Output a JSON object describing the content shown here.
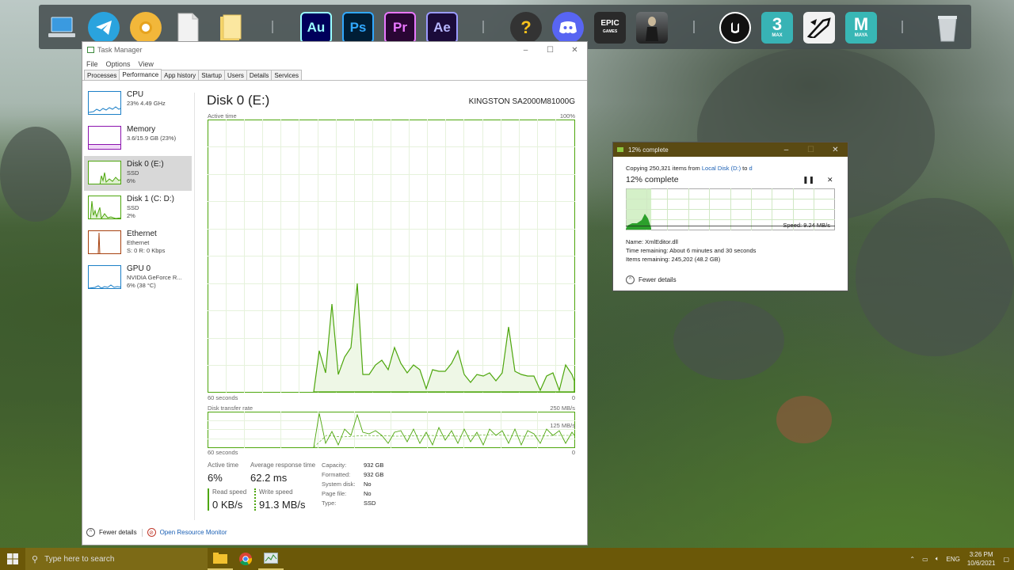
{
  "dock": {
    "icons": [
      {
        "name": "this-pc-icon",
        "label": ""
      },
      {
        "name": "telegram-icon",
        "label": ""
      },
      {
        "name": "chrome-canary-icon",
        "label": ""
      },
      {
        "name": "document-icon",
        "label": ""
      },
      {
        "name": "folder-icon",
        "label": ""
      },
      {
        "name": "audition-icon",
        "label": "Au"
      },
      {
        "name": "photoshop-icon",
        "label": "Ps"
      },
      {
        "name": "premiere-icon",
        "label": "Pr"
      },
      {
        "name": "after-effects-icon",
        "label": "Ae"
      },
      {
        "name": "help-icon",
        "label": "?"
      },
      {
        "name": "discord-icon",
        "label": ""
      },
      {
        "name": "epic-games-icon",
        "label": "EPIC"
      },
      {
        "name": "death-stranding-icon",
        "label": ""
      },
      {
        "name": "unreal-engine-icon",
        "label": ""
      },
      {
        "name": "3ds-max-icon",
        "label": "3"
      },
      {
        "name": "zbrush-icon",
        "label": ""
      },
      {
        "name": "maya-icon",
        "label": "M"
      },
      {
        "name": "recycle-bin-icon",
        "label": ""
      }
    ],
    "max_sub": "MAX",
    "maya_sub": "MAYA",
    "epic_sub": "GAMES"
  },
  "task_manager": {
    "title": "Task Manager",
    "menu": [
      "File",
      "Options",
      "View"
    ],
    "tabs": [
      "Processes",
      "Performance",
      "App history",
      "Startup",
      "Users",
      "Details",
      "Services"
    ],
    "active_tab": "Performance",
    "sidebar": [
      {
        "title": "CPU",
        "sub1": "23%  4.49 GHz",
        "sub2": "",
        "sub3": ""
      },
      {
        "title": "Memory",
        "sub1": "3.6/15.9 GB (23%)",
        "sub2": "",
        "sub3": ""
      },
      {
        "title": "Disk 0 (E:)",
        "sub1": "SSD",
        "sub2": "6%",
        "sub3": ""
      },
      {
        "title": "Disk 1 (C: D:)",
        "sub1": "SSD",
        "sub2": "2%",
        "sub3": ""
      },
      {
        "title": "Ethernet",
        "sub1": "Ethernet",
        "sub2": "S: 0  R: 0 Kbps",
        "sub3": ""
      },
      {
        "title": "GPU 0",
        "sub1": "NVIDIA GeForce R...",
        "sub2": "6% (38 °C)",
        "sub3": ""
      }
    ],
    "main": {
      "title": "Disk 0 (E:)",
      "model": "KINGSTON SA2000M81000G",
      "active_time_label": "Active time",
      "active_time_max": "100%",
      "seconds_label": "60 seconds",
      "zero": "0",
      "transfer_label": "Disk transfer rate",
      "transfer_max": "250 MB/s",
      "transfer_mid": "125 MB/s",
      "stats": {
        "active_time_label": "Active time",
        "active_time": "6%",
        "avg_resp_label": "Average response time",
        "avg_resp": "62.2 ms",
        "read_label": "Read speed",
        "read": "0 KB/s",
        "write_label": "Write speed",
        "write": "91.3 MB/s"
      },
      "props": [
        {
          "k": "Capacity:",
          "v": "932 GB"
        },
        {
          "k": "Formatted:",
          "v": "932 GB"
        },
        {
          "k": "System disk:",
          "v": "No"
        },
        {
          "k": "Page file:",
          "v": "No"
        },
        {
          "k": "Type:",
          "v": "SSD"
        }
      ]
    },
    "footer": {
      "fewer_details": "Fewer details",
      "resource_monitor": "Open Resource Monitor"
    },
    "colors": {
      "disk": "#4da60c",
      "cpu": "#1b7fc7",
      "memory": "#8b12ae",
      "ethernet": "#a7410f"
    }
  },
  "copy_dialog": {
    "title": "12% complete",
    "copying_prefix": "Copying 250,321 items from ",
    "source": "Local Disk (D:)",
    "to": " to ",
    "dest": "d",
    "progress_title": "12% complete",
    "progress": 0.12,
    "speed": "Speed: 9.24 MB/s",
    "name_line": "Name:  XmlEditor.dll",
    "time_line": "Time remaining:  About 6 minutes and 30 seconds",
    "items_line": "Items remaining:  245,202 (48.2 GB)",
    "fewer_details": "Fewer details"
  },
  "taskbar": {
    "search_placeholder": "Type here to search",
    "lang": "ENG",
    "time": "3:26 PM",
    "date": "10/6/2021"
  }
}
